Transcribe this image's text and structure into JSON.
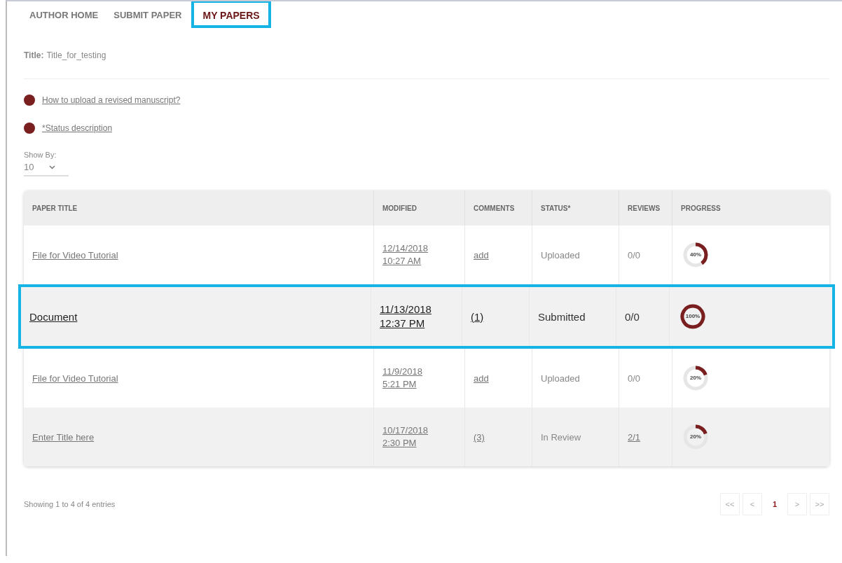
{
  "tabs": [
    {
      "label": "AUTHOR HOME",
      "selected": false,
      "highlighted": false
    },
    {
      "label": "SUBMIT PAPER",
      "selected": false,
      "highlighted": false
    },
    {
      "label": "MY PAPERS",
      "selected": true,
      "highlighted": true
    }
  ],
  "title": {
    "label": "Title:",
    "value": "Title_for_testing"
  },
  "help_links": [
    "How to upload a revised manuscript?",
    "*Status description"
  ],
  "show_by": {
    "label": "Show By:",
    "value": "10"
  },
  "table": {
    "columns": [
      "PAPER TITLE",
      "MODIFIED",
      "COMMENTS",
      "STATUS*",
      "REVIEWS",
      "PROGRESS"
    ],
    "rows": [
      {
        "title": "File for Video Tutorial",
        "modified_date": "12/14/2018",
        "modified_time": "10:27 AM",
        "comments": "add",
        "status": "Uploaded",
        "reviews": "0/0",
        "reviews_link": false,
        "progress": "40%",
        "highlighted": false
      },
      {
        "title": "Document",
        "modified_date": "11/13/2018",
        "modified_time": "12:37 PM",
        "comments": "(1)",
        "status": "Submitted",
        "reviews": "0/0",
        "reviews_link": false,
        "progress": "100%",
        "highlighted": true
      },
      {
        "title": "File for Video Tutorial",
        "modified_date": "11/9/2018",
        "modified_time": "5:21 PM",
        "comments": "add",
        "status": "Uploaded",
        "reviews": "0/0",
        "reviews_link": false,
        "progress": "20%",
        "highlighted": false
      },
      {
        "title": "Enter Title here",
        "modified_date": "10/17/2018",
        "modified_time": "2:30 PM",
        "comments": "(3)",
        "status": "In Review",
        "reviews": "2/1",
        "reviews_link": true,
        "progress": "20%",
        "highlighted": false
      }
    ]
  },
  "footer": "Showing 1 to 4 of 4 entries",
  "pagination": [
    {
      "label": "<<",
      "selected": false
    },
    {
      "label": "<",
      "selected": false
    },
    {
      "label": "1",
      "selected": true
    },
    {
      "label": ">",
      "selected": false
    },
    {
      "label": ">>",
      "selected": false
    }
  ]
}
